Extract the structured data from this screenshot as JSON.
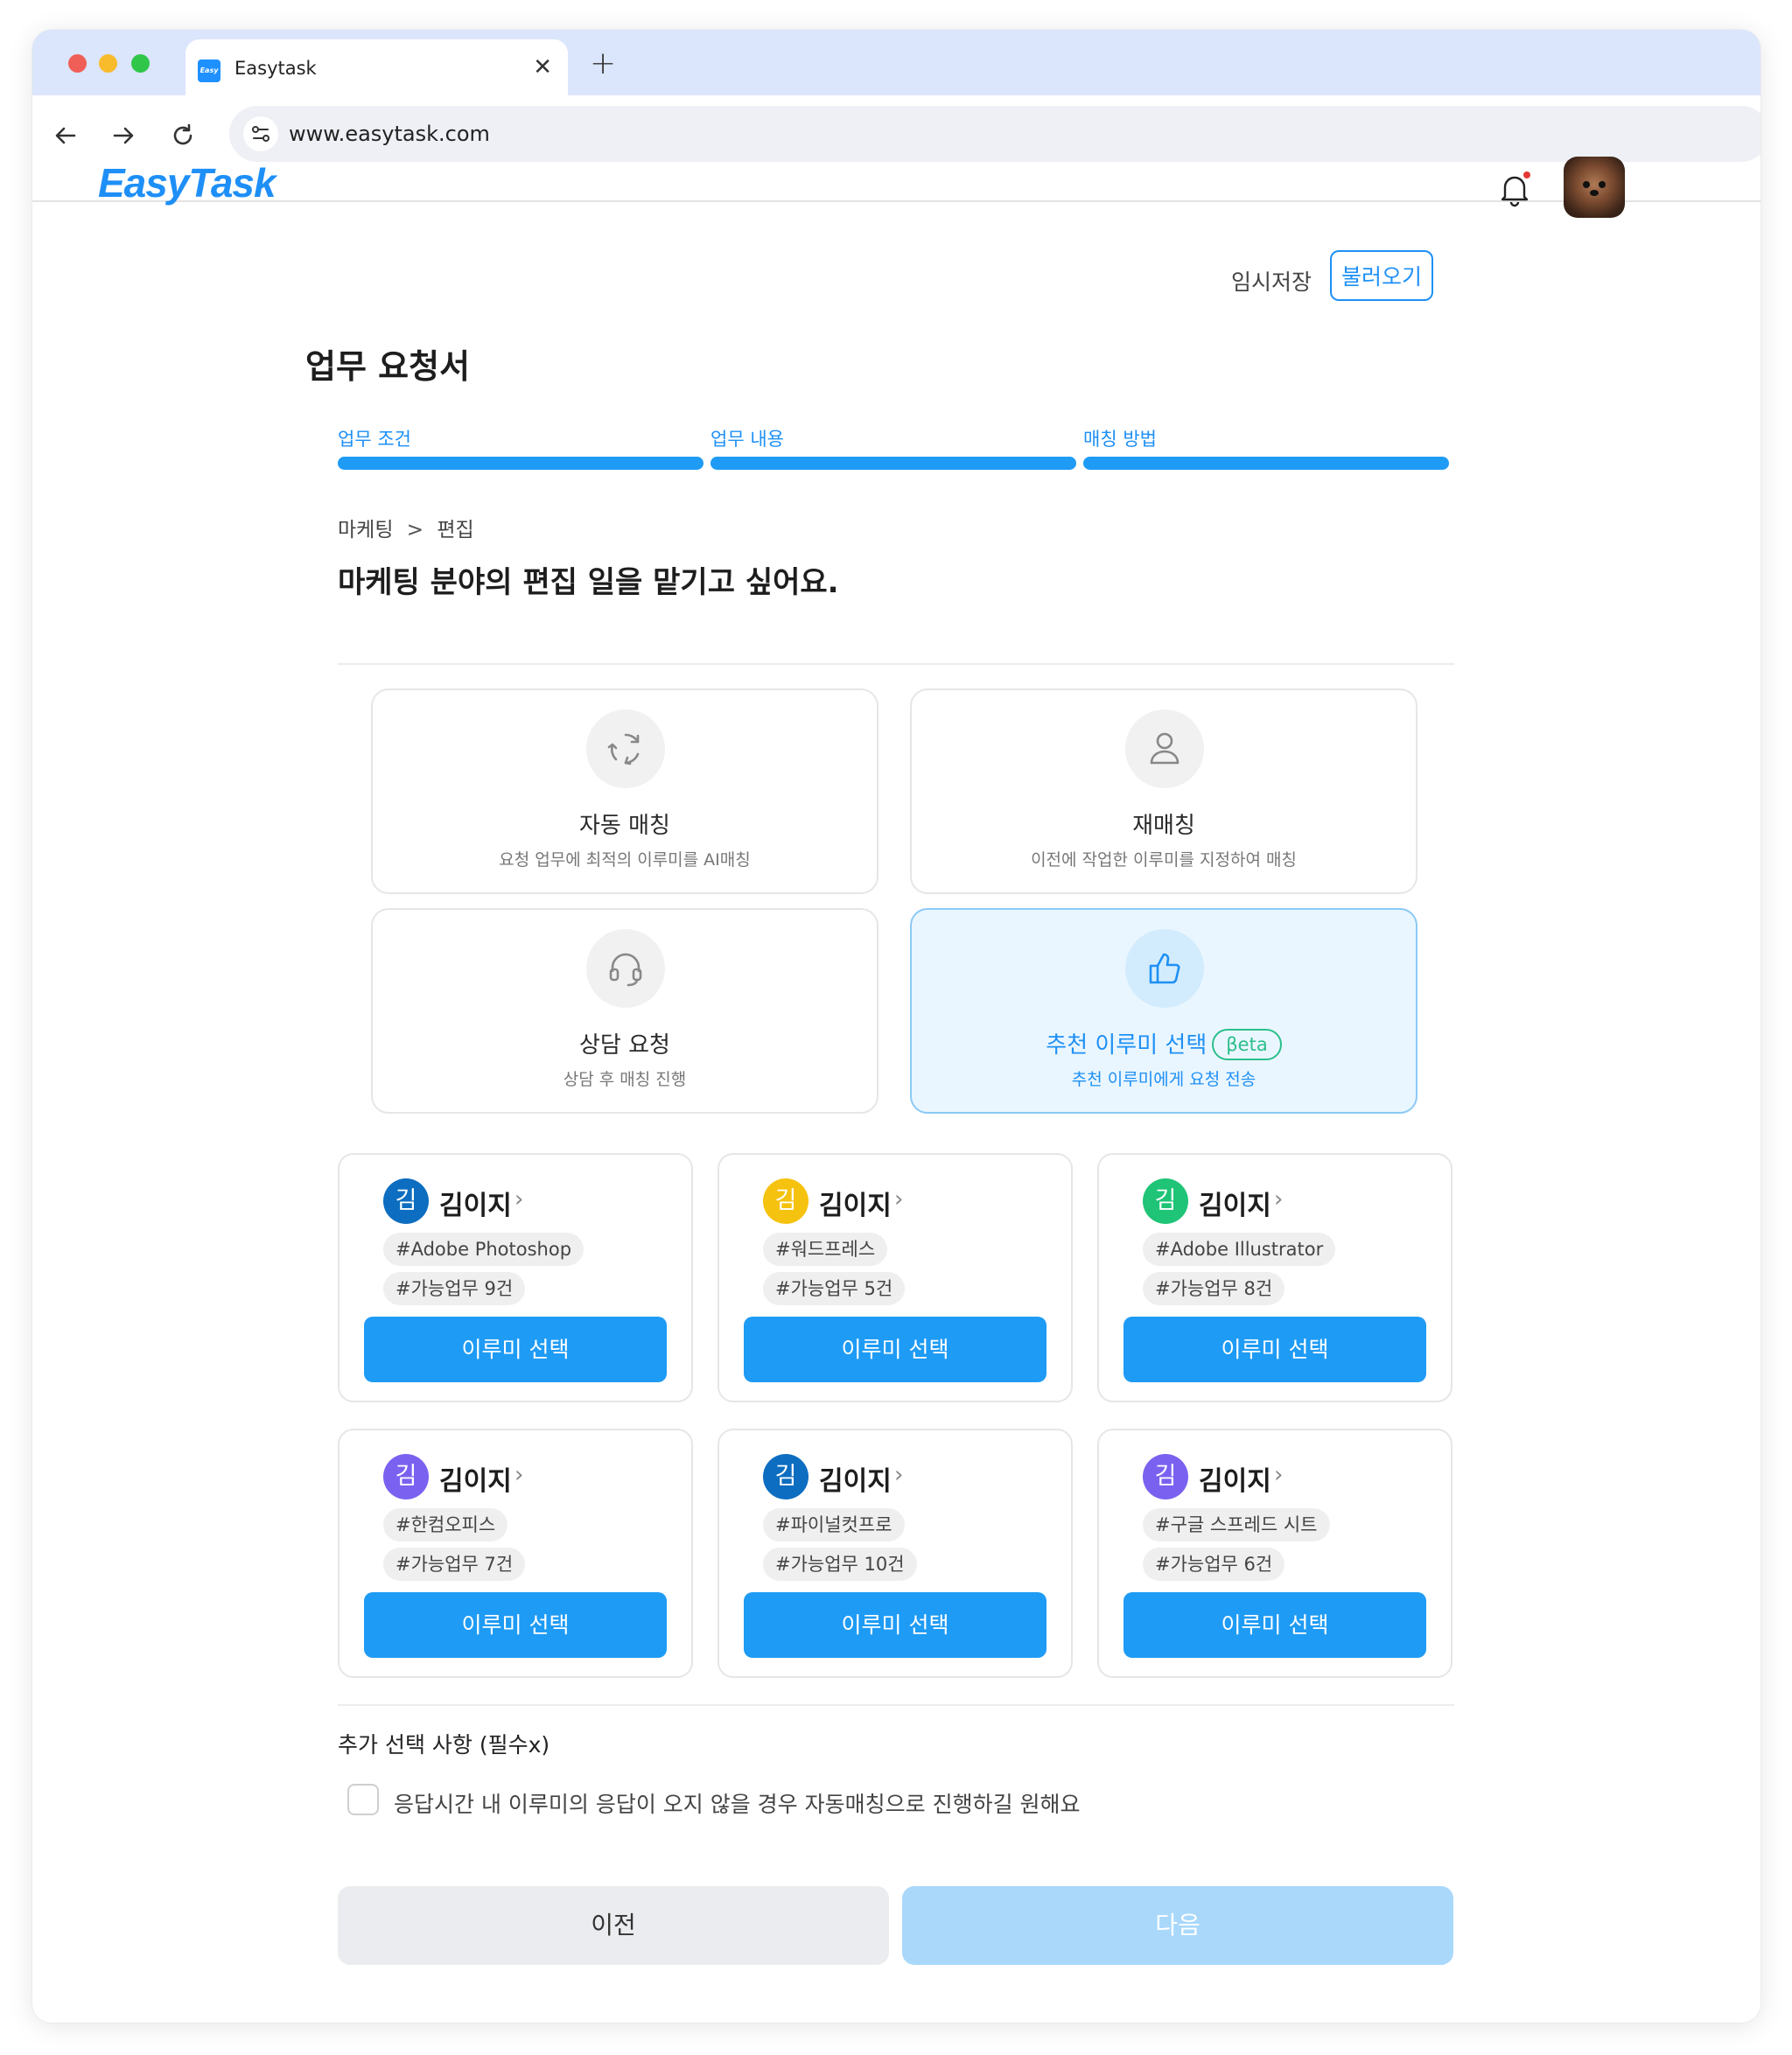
{
  "browser": {
    "tab_title": "Easytask",
    "tab_favicon_text": "Easy",
    "close_symbol": "✕",
    "new_tab_symbol": "+",
    "url": "www.easytask.com"
  },
  "header": {
    "logo": "EasyTask",
    "notification_dot_color": "#e53935"
  },
  "toolbar": {
    "temp_save": "임시저장",
    "load": "불러오기"
  },
  "form": {
    "title": "업무 요청서",
    "steps": [
      "업무 조건",
      "업무 내용",
      "매칭 방법"
    ],
    "breadcrumb": [
      "마케팅",
      "편집"
    ],
    "breadcrumb_separator": ">",
    "headline": "마케팅 분야의  편집 일을 맡기고 싶어요."
  },
  "options": [
    {
      "title": "자동 매칭",
      "sub": "요청 업무에 최적의 이루미를 AI매칭",
      "icon": "refresh-cycle-icon",
      "selected": false
    },
    {
      "title": "재매칭",
      "sub": "이전에 작업한 이루미를 지정하여 매칭",
      "icon": "user-icon",
      "selected": false
    },
    {
      "title": "상담 요청",
      "sub": "상담 후 매칭 진행",
      "icon": "headset-icon",
      "selected": false
    },
    {
      "title": "추천 이루미 선택",
      "badge": "βeta",
      "sub": "추천 이루미에게 요청 전송",
      "icon": "thumbs-up-icon",
      "selected": true
    }
  ],
  "people": [
    {
      "initial": "김",
      "name": "김이지",
      "color": "#0d6dc0",
      "tag1": "#Adobe Photoshop",
      "tag2": "#가능업무 9건",
      "button": "이루미 선택"
    },
    {
      "initial": "김",
      "name": "김이지",
      "color": "#f5c20f",
      "tag1": "#워드프레스",
      "tag2": "#가능업무 5건",
      "button": "이루미 선택"
    },
    {
      "initial": "김",
      "name": "김이지",
      "color": "#1fc476",
      "tag1": "#Adobe Illustrator",
      "tag2": "#가능업무 8건",
      "button": "이루미 선택"
    },
    {
      "initial": "김",
      "name": "김이지",
      "color": "#7b61f0",
      "tag1": "#한컴오피스",
      "tag2": "#가능업무 7건",
      "button": "이루미 선택"
    },
    {
      "initial": "김",
      "name": "김이지",
      "color": "#0d6dc0",
      "tag1": "#파이널컷프로",
      "tag2": "#가능업무 10건",
      "button": "이루미 선택"
    },
    {
      "initial": "김",
      "name": "김이지",
      "color": "#7b61f0",
      "tag1": "#구글 스프레드 시트",
      "tag2": "#가능업무 6건",
      "button": "이루미 선택"
    }
  ],
  "person_chevron": "›",
  "extra": {
    "title": "추가 선택 사항 (필수x)",
    "checkbox_label": "응답시간 내 이루미의 응답이 오지 않을 경우 자동매칭으로 진행하길 원해요",
    "checked": false
  },
  "footer": {
    "prev": "이전",
    "next": "다음"
  }
}
